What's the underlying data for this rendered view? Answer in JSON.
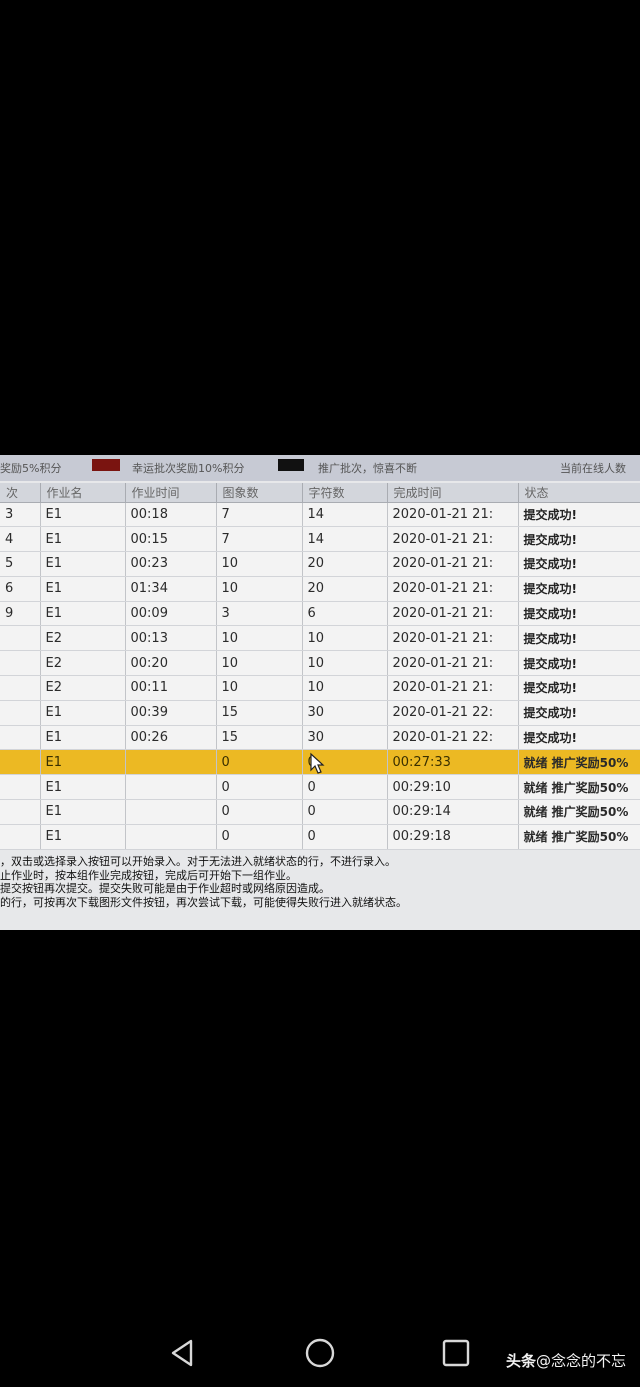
{
  "banner": {
    "left_text": "奖励5%积分",
    "middle_text": "幸运批次奖励10%积分",
    "right_text": "推广批次，惊喜不断",
    "online_text": "当前在线人数",
    "swatch_red": "#7a1410",
    "swatch_black": "#111111"
  },
  "table": {
    "headers": [
      "次",
      "作业名",
      "作业时间",
      "图象数",
      "字符数",
      "完成时间",
      "状态"
    ],
    "rows": [
      {
        "idx": "3",
        "name": "E1",
        "time": "00:18",
        "images": "7",
        "chars": "14",
        "done": "2020-01-21 21:",
        "status": "提交成功!"
      },
      {
        "idx": "4",
        "name": "E1",
        "time": "00:15",
        "images": "7",
        "chars": "14",
        "done": "2020-01-21 21:",
        "status": "提交成功!"
      },
      {
        "idx": "5",
        "name": "E1",
        "time": "00:23",
        "images": "10",
        "chars": "20",
        "done": "2020-01-21 21:",
        "status": "提交成功!"
      },
      {
        "idx": "6",
        "name": "E1",
        "time": "01:34",
        "images": "10",
        "chars": "20",
        "done": "2020-01-21 21:",
        "status": "提交成功!"
      },
      {
        "idx": "9",
        "name": "E1",
        "time": "00:09",
        "images": "3",
        "chars": "6",
        "done": "2020-01-21 21:",
        "status": "提交成功!"
      },
      {
        "idx": "",
        "name": "E2",
        "time": "00:13",
        "images": "10",
        "chars": "10",
        "done": "2020-01-21 21:",
        "status": "提交成功!"
      },
      {
        "idx": "",
        "name": "E2",
        "time": "00:20",
        "images": "10",
        "chars": "10",
        "done": "2020-01-21 21:",
        "status": "提交成功!"
      },
      {
        "idx": "",
        "name": "E2",
        "time": "00:11",
        "images": "10",
        "chars": "10",
        "done": "2020-01-21 21:",
        "status": "提交成功!"
      },
      {
        "idx": "",
        "name": "E1",
        "time": "00:39",
        "images": "15",
        "chars": "30",
        "done": "2020-01-21 22:",
        "status": "提交成功!"
      },
      {
        "idx": "",
        "name": "E1",
        "time": "00:26",
        "images": "15",
        "chars": "30",
        "done": "2020-01-21 22:",
        "status": "提交成功!"
      },
      {
        "idx": "",
        "name": "E1",
        "time": "",
        "images": "0",
        "chars": "0",
        "done": "00:27:33",
        "status": "就绪 推广奖励50%"
      },
      {
        "idx": "",
        "name": "E1",
        "time": "",
        "images": "0",
        "chars": "0",
        "done": "00:29:10",
        "status": "就绪 推广奖励50%"
      },
      {
        "idx": "",
        "name": "E1",
        "time": "",
        "images": "0",
        "chars": "0",
        "done": "00:29:14",
        "status": "就绪 推广奖励50%"
      },
      {
        "idx": "",
        "name": "E1",
        "time": "",
        "images": "0",
        "chars": "0",
        "done": "00:29:18",
        "status": "就绪 推广奖励50%"
      }
    ]
  },
  "notes": {
    "line1": "，双击或选择录入按钮可以开始录入。对于无法进入就绪状态的行，不进行录入。",
    "line2": "止作业时，按本组作业完成按钮，完成后可开始下一组作业。",
    "line3": "提交按钮再次提交。提交失败可能是由于作业超时或网络原因造成。",
    "line4": "的行，可按再次下载图形文件按钮，再次尝试下载，可能使得失败行进入就绪状态。"
  },
  "watermark": {
    "brand": "头条",
    "handle": "@念念的不忘"
  }
}
